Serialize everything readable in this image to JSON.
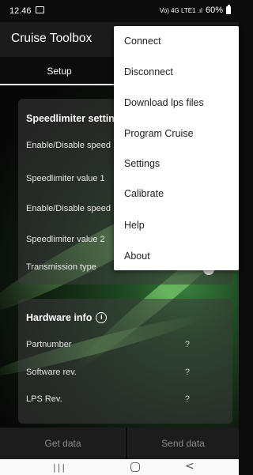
{
  "status_bar": {
    "time": "12.46",
    "signal": "Vo) 4G LTE1 .ıl",
    "battery": "60%"
  },
  "app": {
    "title": "Cruise Toolbox"
  },
  "tabs": [
    {
      "label": "Setup"
    }
  ],
  "speedlimiter": {
    "title": "Speedlimiter settin",
    "rows": [
      {
        "label": "Enable/Disable speed"
      },
      {
        "label": "Speedlimiter value 1"
      },
      {
        "label": "Enable/Disable speed"
      },
      {
        "label": "Speedlimiter value 2"
      },
      {
        "label": "Transmission type"
      }
    ]
  },
  "hardware": {
    "title": "Hardware info",
    "rows": [
      {
        "label": "Partnumber",
        "value": "?"
      },
      {
        "label": "Software rev.",
        "value": "?"
      },
      {
        "label": "LPS Rev.",
        "value": "?"
      }
    ]
  },
  "buttons": {
    "get_data": "Get data",
    "send_data": "Send data"
  },
  "menu": {
    "items": [
      {
        "label": "Connect"
      },
      {
        "label": "Disconnect"
      },
      {
        "label": "Download lps files"
      },
      {
        "label": "Program Cruise"
      },
      {
        "label": "Settings"
      },
      {
        "label": "Calibrate"
      },
      {
        "label": "Help"
      },
      {
        "label": "About"
      }
    ]
  },
  "nav": {
    "recents": "|||",
    "home": "",
    "back": "<"
  },
  "icons": {
    "info": "info-icon",
    "gallery": "image-icon",
    "battery": "battery-icon"
  }
}
